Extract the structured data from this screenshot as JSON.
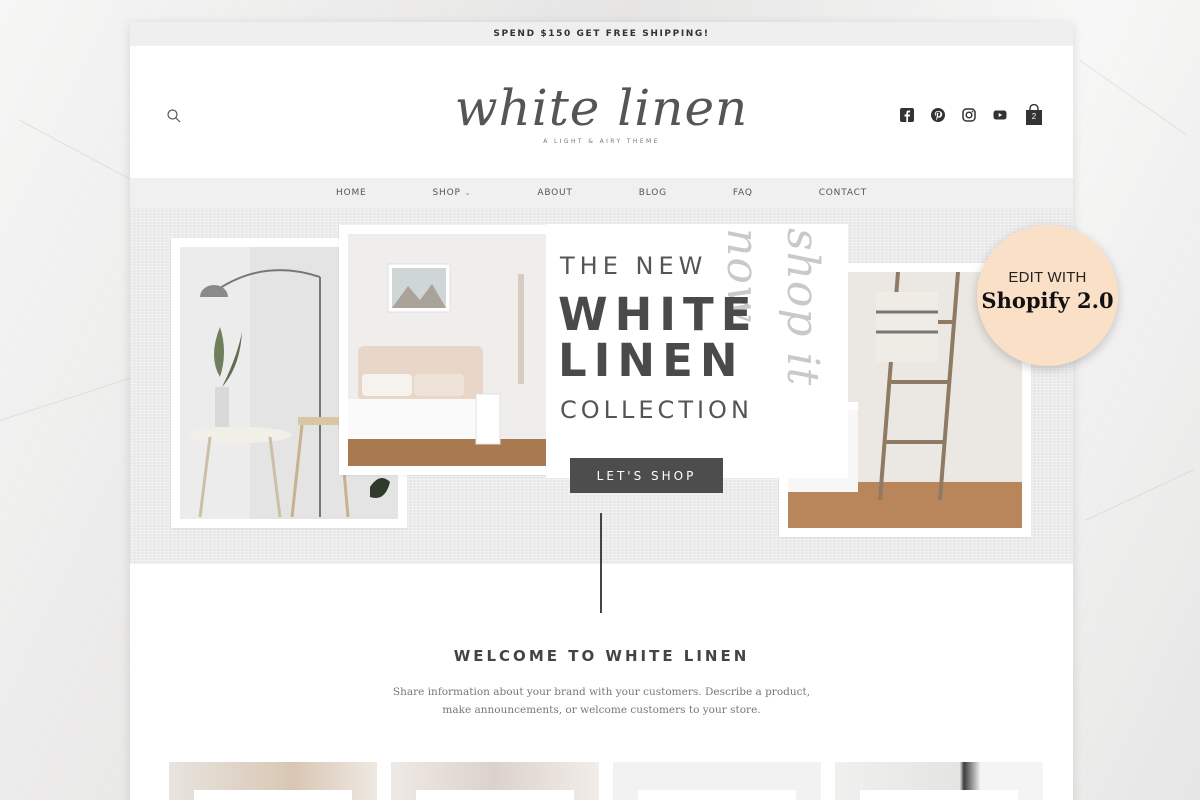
{
  "announcement": "SPEND $150 GET FREE SHIPPING!",
  "header": {
    "logo_text": "white linen",
    "logo_tagline": "A LIGHT & AIRY THEME",
    "cart_count": "2"
  },
  "nav": {
    "items": [
      {
        "label": "HOME"
      },
      {
        "label": "SHOP"
      },
      {
        "label": "ABOUT"
      },
      {
        "label": "BLOG"
      },
      {
        "label": "FAQ"
      },
      {
        "label": "CONTACT"
      }
    ]
  },
  "hero": {
    "line1": "THE NEW",
    "line2": "WHITE",
    "line3": "LINEN",
    "line4": "COLLECTION",
    "script": "shop it now",
    "cta": "LET'S SHOP"
  },
  "badge": {
    "line1": "EDIT WITH",
    "line2": "Shopify 2.0"
  },
  "welcome": {
    "title": "WELCOME TO WHITE LINEN",
    "body": "Share information about your brand with your customers. Describe a product, make announcements, or welcome customers to your store."
  },
  "colors": {
    "accent_dark": "#4d4d4d",
    "badge_peach": "#fbe0c8",
    "nav_bg": "#f0f0f0"
  },
  "icons": [
    "search-icon",
    "facebook-icon",
    "pinterest-icon",
    "instagram-icon",
    "youtube-icon",
    "cart-icon"
  ]
}
